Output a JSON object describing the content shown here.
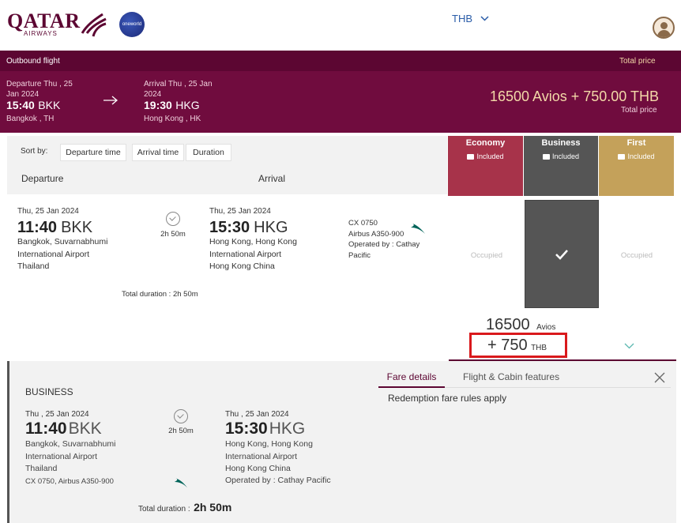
{
  "header": {
    "logo": "QATAR",
    "logo_sub": "AIRWAYS",
    "alliance": "oneworld",
    "currency": "THB"
  },
  "outbound": {
    "label": "Outbound flight",
    "total_price_label": "Total price",
    "departure_label": "Departure Thu , 25 Jan 2024",
    "departure_time": "15:40",
    "departure_code": "BKK",
    "departure_city": "Bangkok , TH",
    "arrival_label": "Arrival Thu , 25 Jan 2024",
    "arrival_time": "19:30",
    "arrival_code": "HKG",
    "arrival_city": "Hong Kong , HK",
    "price": "16500 Avios + 750.00 THB",
    "price_sub": "Total price"
  },
  "sort": {
    "label": "Sort by:",
    "options": [
      "Departure time",
      "Arrival time",
      "Duration"
    ]
  },
  "columns": {
    "departure": "Departure",
    "arrival": "Arrival"
  },
  "cabins": [
    {
      "name": "Economy",
      "included": "Included",
      "color": "#a7334a"
    },
    {
      "name": "Business",
      "included": "Included",
      "color": "#555555"
    },
    {
      "name": "First",
      "included": "Included",
      "color": "#c4a15a"
    }
  ],
  "flight": {
    "dep_date": "Thu, 25 Jan 2024",
    "dep_time": "11:40",
    "dep_code": "BKK",
    "dep_loc1": "Bangkok, Suvarnabhumi",
    "dep_loc2": "International Airport",
    "dep_loc3": "Thailand",
    "duration": "2h 50m",
    "arr_date": "Thu, 25 Jan 2024",
    "arr_time": "15:30",
    "arr_code": "HKG",
    "arr_loc1": "Hong Kong, Hong Kong",
    "arr_loc2": "International Airport",
    "arr_loc3": "Hong Kong China",
    "flight_no": "CX 0750",
    "aircraft": "Airbus A350-900",
    "operated_1": "Operated by : Cathay",
    "operated_2": "Pacific",
    "total_duration": "Total duration : 2h 50m",
    "occupied": "Occupied",
    "avios": "16500",
    "avios_label": "Avios",
    "thb": "+ 750",
    "thb_label": "THB"
  },
  "details": {
    "cabin": "BUSINESS",
    "tab_fare": "Fare details",
    "tab_cabin": "Flight & Cabin features",
    "fare_rule": "Redemption fare rules apply",
    "dep_date": "Thu , 25 Jan 2024",
    "dep_time": "11:40",
    "dep_code": "BKK",
    "dep_loc1": "Bangkok, Suvarnabhumi",
    "dep_loc2": "International Airport",
    "dep_loc3": "Thailand",
    "flight_info": "CX 0750, Airbus A350-900",
    "duration": "2h 50m",
    "arr_date": "Thu , 25 Jan 2024",
    "arr_time": "15:30",
    "arr_code": "HKG",
    "arr_loc1": "Hong Kong, Hong Kong",
    "arr_loc2": "International Airport",
    "arr_loc3": "Hong Kong China",
    "operated": "Operated by : Cathay Pacific",
    "total_label": "Total duration :",
    "total_value": "2h 50m"
  }
}
